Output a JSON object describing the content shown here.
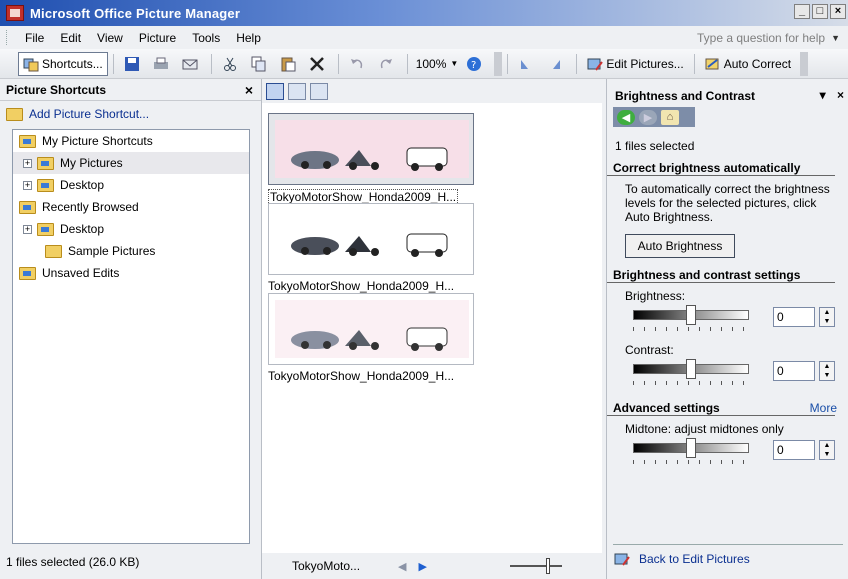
{
  "window": {
    "title": "Microsoft Office Picture Manager",
    "buttons": [
      "_",
      "□",
      "×"
    ]
  },
  "menu": {
    "items": [
      "File",
      "Edit",
      "View",
      "Picture",
      "Tools",
      "Help"
    ],
    "help_placeholder": "Type a question for help"
  },
  "toolbar": {
    "shortcuts_label": "Shortcuts...",
    "zoom": "100%",
    "edit_pictures_label": "Edit Pictures...",
    "auto_correct_label": "Auto Correct"
  },
  "left_pane": {
    "title": "Picture Shortcuts",
    "add_shortcut": "Add Picture Shortcut...",
    "tree": [
      {
        "label": "My Picture Shortcuts",
        "level": 0,
        "expander": false
      },
      {
        "label": "My Pictures",
        "level": 1,
        "expander": true,
        "selected": true
      },
      {
        "label": "Desktop",
        "level": 1,
        "expander": true
      },
      {
        "label": "Recently Browsed",
        "level": 0,
        "expander": false
      },
      {
        "label": "Desktop",
        "level": 1,
        "expander": true
      },
      {
        "label": "Sample Pictures",
        "level": 2,
        "expander": false
      },
      {
        "label": "Unsaved Edits",
        "level": 0,
        "expander": false
      }
    ],
    "status": "1 files selected (26.0 KB)"
  },
  "center_pane": {
    "thumbnails": [
      {
        "label": "TokyoMotorShow_Honda2009_H...",
        "selected": true
      },
      {
        "label": "TokyoMotorShow_Honda2009_H...",
        "selected": false
      },
      {
        "label": "TokyoMotorShow_Honda2009_H...",
        "selected": false
      }
    ],
    "status_filename": "TokyoMoto..."
  },
  "right_pane": {
    "title": "Brightness and Contrast",
    "files_selected": "1 files selected",
    "auto_section": "Correct brightness automatically",
    "auto_desc": "To automatically correct the brightness levels for the selected pictures, click Auto Brightness.",
    "auto_button": "Auto Brightness",
    "settings_section": "Brightness and contrast settings",
    "brightness_label": "Brightness:",
    "brightness_value": "0",
    "contrast_label": "Contrast:",
    "contrast_value": "0",
    "advanced_section": "Advanced settings",
    "more_link": "More",
    "midtone_label": "Midtone: adjust midtones only",
    "midtone_value": "0",
    "back_link": "Back to Edit Pictures"
  }
}
